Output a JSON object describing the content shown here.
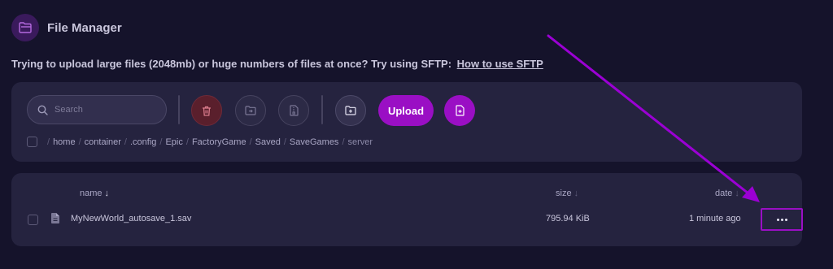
{
  "header": {
    "title": "File Manager",
    "icon": "folder-open-icon"
  },
  "notice": {
    "text": "Trying to upload large files (2048mb) or huge numbers of files at once? Try using SFTP:",
    "link": "How to use SFTP"
  },
  "toolbar": {
    "search_placeholder": "Search",
    "upload_label": "Upload",
    "delete_icon": "trash-icon",
    "move_icon": "folder-move-icon",
    "archive_icon": "archive-icon",
    "new_folder_icon": "folder-plus-icon",
    "new_file_icon": "file-plus-icon"
  },
  "breadcrumb": [
    "home",
    "container",
    ".config",
    "Epic",
    "FactoryGame",
    "Saved",
    "SaveGames",
    "server"
  ],
  "table": {
    "columns": {
      "name": "name",
      "size": "size",
      "date": "date"
    },
    "sort_arrow": "↓",
    "rows": [
      {
        "name": "MyNewWorld_autosave_1.sav",
        "size": "795.94 KiB",
        "date": "1 minute ago"
      }
    ]
  },
  "colors": {
    "accent": "#9a0fc4",
    "background": "#15132b",
    "panel": "#25233f",
    "delete": "#5a1f2c",
    "annotation": "#9b00d4"
  }
}
